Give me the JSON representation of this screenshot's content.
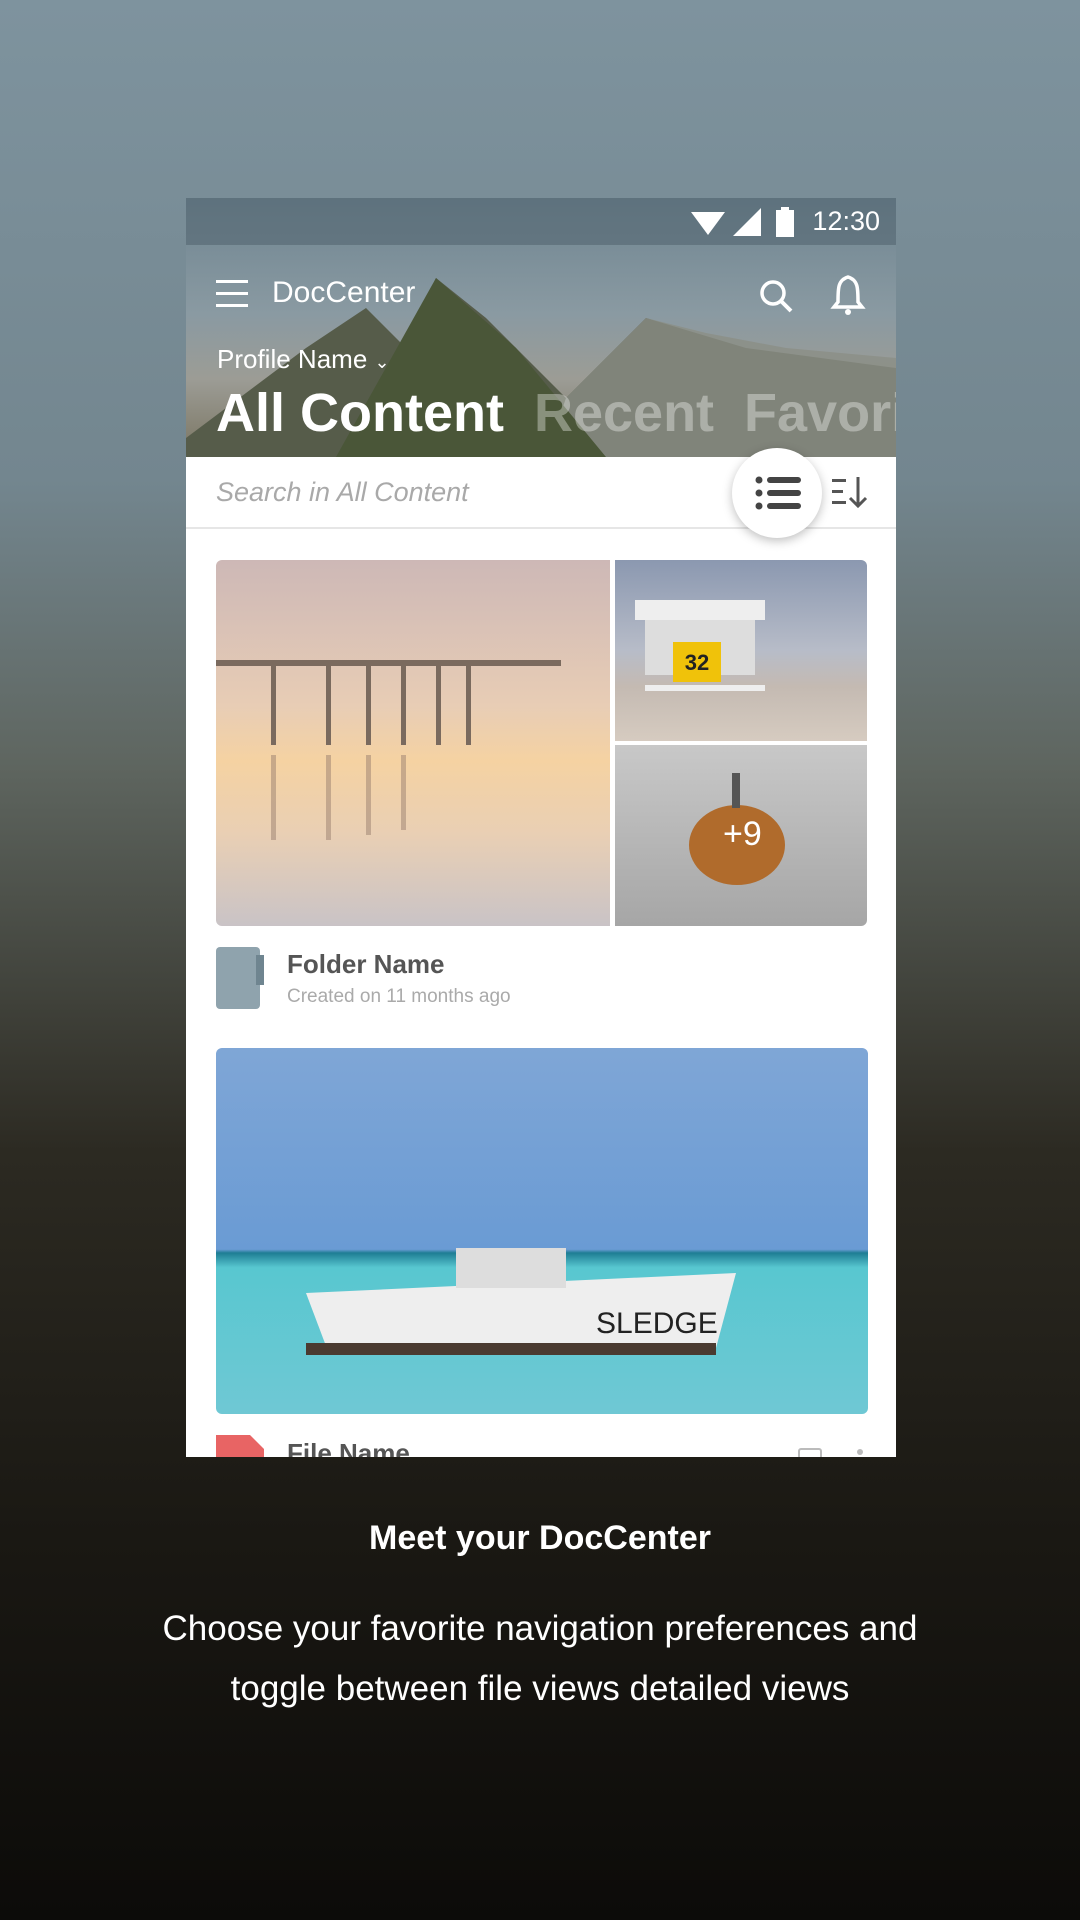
{
  "status_bar": {
    "time": "12:30"
  },
  "app": {
    "title": "DocCenter",
    "profile": "Profile Name"
  },
  "tabs": [
    {
      "label": "All Content",
      "active": true
    },
    {
      "label": "Recent",
      "active": false
    },
    {
      "label": "Favorites",
      "active": false
    }
  ],
  "search": {
    "placeholder": "Search in All Content"
  },
  "items": [
    {
      "type": "folder",
      "name": "Folder Name",
      "meta": "Created on 11 months ago",
      "extra_count": "+9"
    },
    {
      "type": "file",
      "name": "File Name"
    }
  ],
  "onboarding": {
    "heading": "Meet your DocCenter",
    "body_line1": "Choose your favorite navigation preferences and",
    "body_line2": "toggle between file views detailed views"
  },
  "colors": {
    "folder": "#8fa3ad",
    "file": "#e86464"
  }
}
